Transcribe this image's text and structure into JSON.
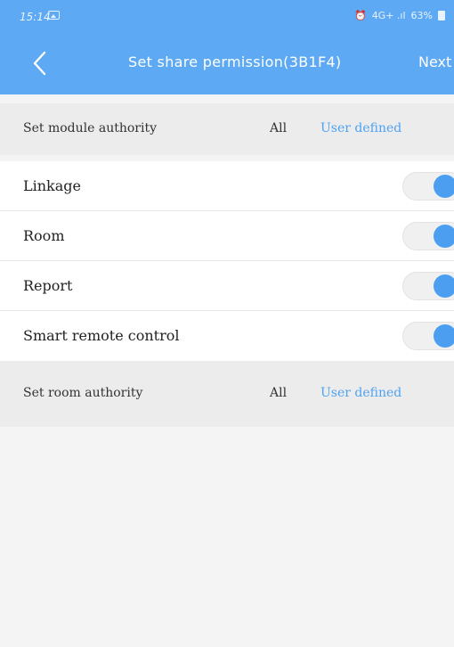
{
  "status_bar": {
    "time": "15:14",
    "indicators": "4G+ .ıl",
    "battery": "63%"
  },
  "header": {
    "title": "Set share permission(3B1F4)",
    "next_label": "Next"
  },
  "module_section": {
    "label": "Set module authority",
    "option_all": "All",
    "option_user_defined": "User defined"
  },
  "modules": [
    {
      "label": "Linkage",
      "enabled": true
    },
    {
      "label": "Room",
      "enabled": true
    },
    {
      "label": "Report",
      "enabled": true
    },
    {
      "label": "Smart remote control",
      "enabled": true
    }
  ],
  "room_section": {
    "label": "Set room authority",
    "option_all": "All",
    "option_user_defined": "User defined"
  },
  "colors": {
    "header_bg": "#5ea9f3",
    "accent": "#4c9ef0"
  }
}
